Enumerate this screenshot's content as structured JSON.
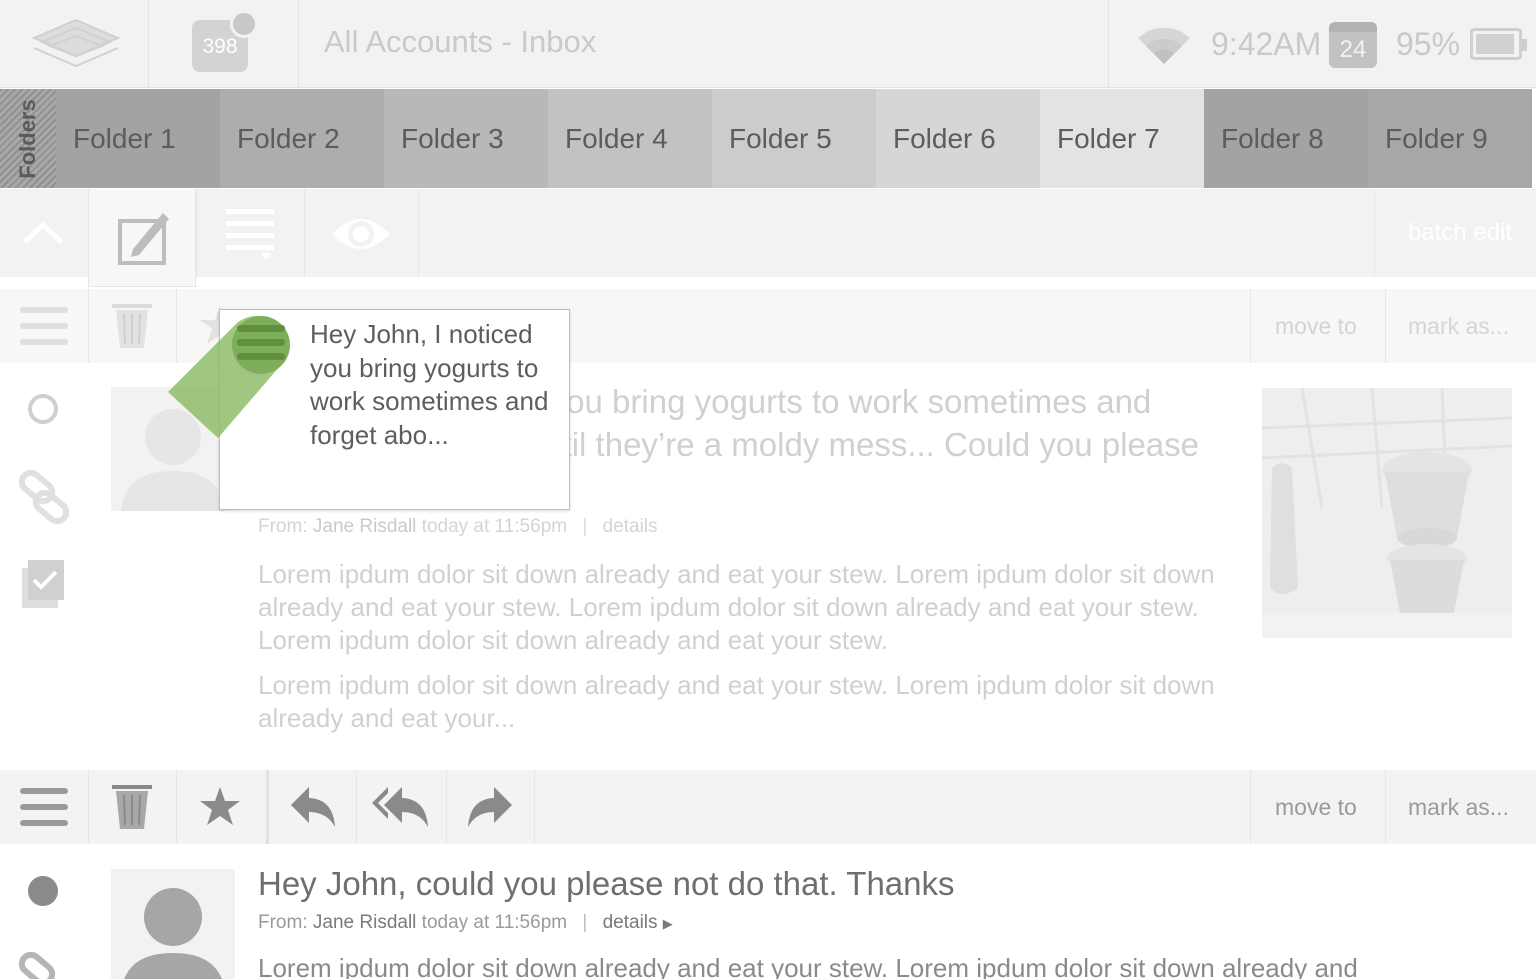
{
  "status_bar": {
    "unread_count": "398",
    "title": "All Accounts - Inbox",
    "time": "9:42AM",
    "calendar_day": "24",
    "battery_percent": "95%",
    "battery_level": 0.95
  },
  "folders": {
    "label": "Folders",
    "items": [
      {
        "label": "Folder 1",
        "color": "#a3a3a3"
      },
      {
        "label": "Folder 2",
        "color": "#adadad"
      },
      {
        "label": "Folder 3",
        "color": "#b8b8b8"
      },
      {
        "label": "Folder 4",
        "color": "#c2c2c2"
      },
      {
        "label": "Folder 5",
        "color": "#cccccc"
      },
      {
        "label": "Folder 6",
        "color": "#d6d6d6"
      },
      {
        "label": "Folder 7",
        "color": "#e3e3e3"
      },
      {
        "label": "Folder 8",
        "color": "#a3a3a3"
      },
      {
        "label": "Folder 9",
        "color": "#a8a8a8"
      }
    ]
  },
  "toolbar": {
    "batch_edit": "batch edit"
  },
  "messages": [
    {
      "actions": {
        "move_to": "move to",
        "mark_as": "mark as..."
      },
      "title": "Hey John, I noticed you bring yogurts to work sometimes and forget about them until they’re a moldy mess... Could you please not do that. Thanks",
      "from_label": "From:",
      "sender": "Jane Risdall",
      "date": "today at 11:56pm",
      "details": "details",
      "paragraphs": [
        "Lorem ipdum dolor sit down already and eat your stew. Lorem ipdum dolor sit down already and eat your stew. Lorem ipdum dolor sit down already and eat your stew. Lorem ipdum dolor sit down already and eat your stew.",
        "Lorem ipdum dolor sit down already and eat your stew. Lorem ipdum dolor sit down already and eat your..."
      ],
      "tooltip": "Hey John, I noticed you bring yogurts to work sometimes and forget abo..."
    },
    {
      "actions": {
        "move_to": "move to",
        "mark_as": "mark as..."
      },
      "title": "Hey John, could you please not do that. Thanks",
      "from_label": "From:",
      "sender": "Jane Risdall",
      "date": "today at 11:56pm",
      "details": "details",
      "paragraphs": [
        "Lorem ipdum dolor sit down already and eat your stew. Lorem ipdum dolor sit down already and"
      ]
    }
  ],
  "colors": {
    "accent_green": "#8fbc6a",
    "toolbar_bg": "#f2f2f2"
  }
}
